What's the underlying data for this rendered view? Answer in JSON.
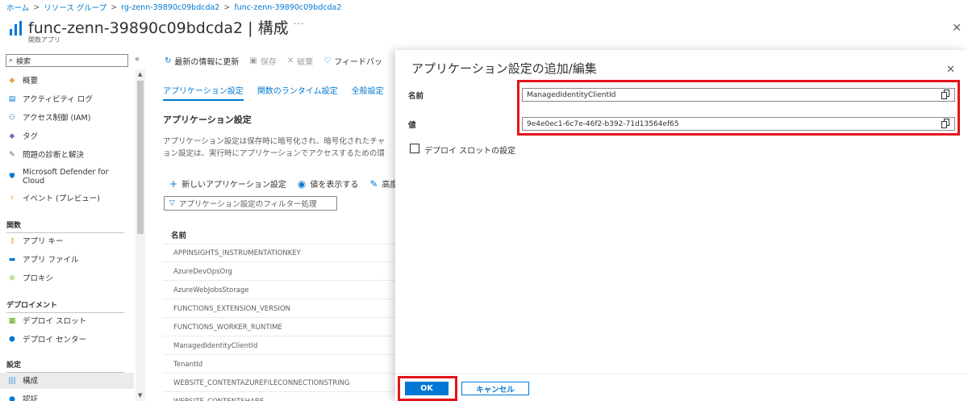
{
  "breadcrumb": {
    "items": [
      "ホーム",
      "リソース グループ",
      "rg-zenn-39890c09bdcda2",
      "func-zenn-39890c09bdcda2"
    ],
    "separator": ">"
  },
  "header": {
    "title": "func-zenn-39890c09bdcda2 | 構成",
    "subtitle": "関数アプリ",
    "star_glyph": "☆",
    "more_glyph": "···",
    "close_glyph": "✕"
  },
  "sidebar": {
    "search_placeholder": "検索",
    "collapse_glyph": "«",
    "items_top": [
      {
        "label": "概要",
        "icon": "overview-icon",
        "glyph": "◆",
        "color": "#e8a33a"
      },
      {
        "label": "アクティビティ ログ",
        "icon": "activity-log-icon",
        "glyph": "▤",
        "color": "#0078d4"
      },
      {
        "label": "アクセス制御 (IAM)",
        "icon": "iam-icon",
        "glyph": "⚇",
        "color": "#0078d4"
      },
      {
        "label": "タグ",
        "icon": "tag-icon",
        "glyph": "◆",
        "color": "#8764b8"
      },
      {
        "label": "問題の診断と解決",
        "icon": "wrench-icon",
        "glyph": "✎",
        "color": "#605e5c"
      },
      {
        "label": "Microsoft Defender for Cloud",
        "icon": "defender-icon",
        "glyph": "⛊",
        "color": "#0078d4"
      },
      {
        "label": "イベント (プレビュー)",
        "icon": "event-icon",
        "glyph": "⚡",
        "color": "#e8a33a"
      }
    ],
    "section_functions": "関数",
    "items_functions": [
      {
        "label": "アプリ キー",
        "icon": "key-icon",
        "glyph": "⚷",
        "color": "#e8a33a"
      },
      {
        "label": "アプリ ファイル",
        "icon": "app-files-icon",
        "glyph": "▬",
        "color": "#0078d4"
      },
      {
        "label": "プロキシ",
        "icon": "proxy-icon",
        "glyph": "⊕",
        "color": "#8dc63f"
      }
    ],
    "section_deployment": "デプロイメント",
    "items_deployment": [
      {
        "label": "デプロイ スロット",
        "icon": "deployment-slot-icon",
        "glyph": "▦",
        "color": "#57a300"
      },
      {
        "label": "デプロイ センター",
        "icon": "deployment-center-icon",
        "glyph": "⬢",
        "color": "#0078d4"
      }
    ],
    "section_settings": "設定",
    "items_settings": [
      {
        "label": "構成",
        "icon": "configuration-icon",
        "glyph": "|||",
        "color": "#0078d4",
        "active": true
      },
      {
        "label": "認証",
        "icon": "auth-icon",
        "glyph": "●",
        "color": "#0078d4"
      }
    ]
  },
  "toolbar": {
    "refresh": "最新の情報に更新",
    "save": "保存",
    "discard": "破棄",
    "feedback": "フィードバッ"
  },
  "tabs": [
    "アプリケーション設定",
    "関数のランタイム設定",
    "全般設定"
  ],
  "main": {
    "section_title": "アプリケーション設定",
    "description": [
      "アプリケーション設定は保存時に暗号化され、暗号化されたチャ",
      "ョン設定は、実行時にアプリケーションでアクセスするための環"
    ],
    "new_setting": "新しいアプリケーション設定",
    "show_values": "値を表示する",
    "advanced": "高度",
    "filter_placeholder": "アプリケーション設定のフィルター処理",
    "column_name": "名前",
    "rows": [
      "APPINSIGHTS_INSTRUMENTATIONKEY",
      "AzureDevOpsOrg",
      "AzureWebJobsStorage",
      "FUNCTIONS_EXTENSION_VERSION",
      "FUNCTIONS_WORKER_RUNTIME",
      "ManagedIdentityClientId",
      "TenantId",
      "WEBSITE_CONTENTAZUREFILECONNECTIONSTRING",
      "WEBSITE_CONTENTSHARE"
    ]
  },
  "panel": {
    "title": "アプリケーション設定の追加/編集",
    "close_glyph": "✕",
    "name_label": "名前",
    "name_value": "ManagedIdentityClientId",
    "value_label": "値",
    "value_value": "9e4e0ec1-6c7e-46f2-b392-71d13564ef65",
    "slot_setting_label": "デプロイ スロットの設定",
    "slot_setting_checked": false,
    "ok_label": "OK",
    "cancel_label": "キャンセル",
    "highlight_color": "#e3141c"
  },
  "accent_color": "#0078d4"
}
